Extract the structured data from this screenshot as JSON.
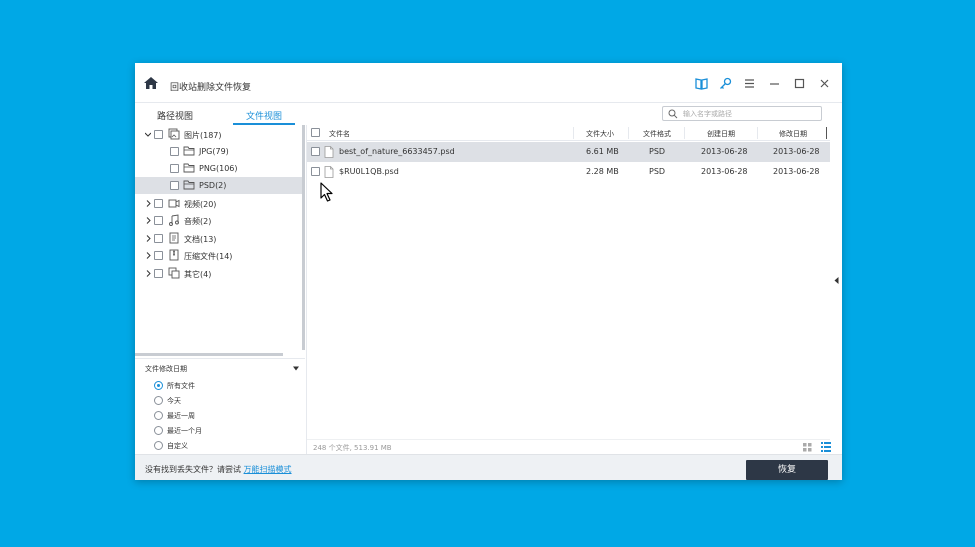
{
  "window": {
    "title": "回收站删除文件恢复"
  },
  "tabs": [
    {
      "label": "路径视图",
      "active": false
    },
    {
      "label": "文件视图",
      "active": true
    }
  ],
  "search": {
    "placeholder": "输入名字或路径"
  },
  "tree": [
    {
      "label": "图片(187)",
      "expanded": true,
      "icon": "image-folder-icon"
    },
    {
      "label": "JPG(79)",
      "child": true,
      "icon": "folder-icon"
    },
    {
      "label": "PNG(106)",
      "child": true,
      "icon": "folder-icon"
    },
    {
      "label": "PSD(2)",
      "child": true,
      "selected": true,
      "icon": "folder-icon"
    },
    {
      "label": "视频(20)",
      "icon": "video-icon"
    },
    {
      "label": "音频(2)",
      "icon": "music-icon"
    },
    {
      "label": "文档(13)",
      "icon": "document-icon"
    },
    {
      "label": "压缩文件(14)",
      "icon": "archive-icon"
    },
    {
      "label": "其它(4)",
      "icon": "other-icon"
    }
  ],
  "filter": {
    "title": "文件修改日期",
    "options": [
      {
        "label": "所有文件",
        "checked": true
      },
      {
        "label": "今天",
        "checked": false
      },
      {
        "label": "最近一周",
        "checked": false
      },
      {
        "label": "最近一个月",
        "checked": false
      },
      {
        "label": "自定义",
        "checked": false
      }
    ]
  },
  "table": {
    "columns": [
      "文件名",
      "文件大小",
      "文件格式",
      "创建日期",
      "修改日期"
    ],
    "rows": [
      {
        "name": "best_of_nature_6633457.psd",
        "size": "6.61 MB",
        "format": "PSD",
        "created": "2013-06-28",
        "modified": "2013-06-28"
      },
      {
        "name": "$RU0L1QB.psd",
        "size": "2.28 MB",
        "format": "PSD",
        "created": "2013-06-28",
        "modified": "2013-06-28"
      }
    ]
  },
  "status": {
    "text": "248 个文件, 513.91 MB"
  },
  "footer": {
    "prompt": "没有找到丢失文件？请尝试 ",
    "link": "万能扫描模式",
    "recover_label": "恢复"
  },
  "colors": {
    "background": "#00a8e6",
    "accent": "#1a8fd8",
    "button_dark": "#2d3746",
    "selected_row": "#dde0e5"
  }
}
